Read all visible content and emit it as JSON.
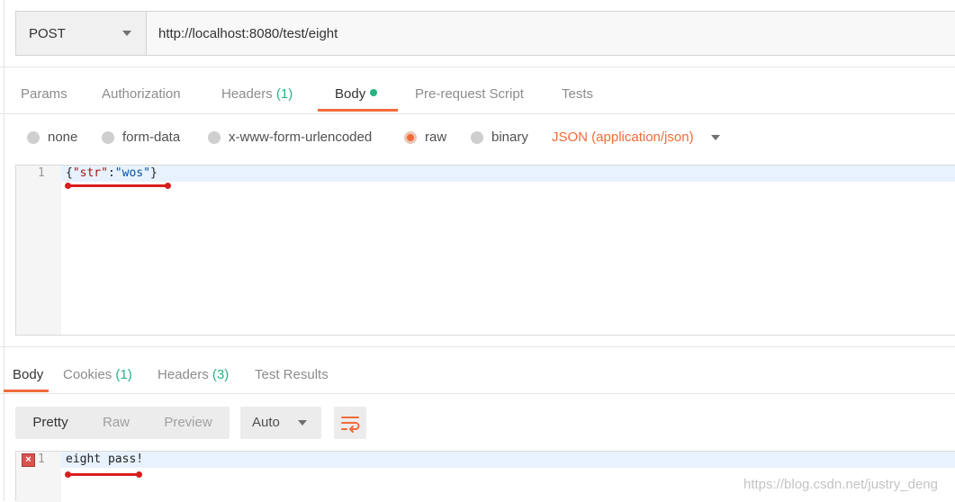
{
  "request": {
    "method": "POST",
    "url": "http://localhost:8080/test/eight"
  },
  "request_tabs": {
    "params": "Params",
    "authorization": "Authorization",
    "headers": "Headers",
    "headers_count": "(1)",
    "body": "Body",
    "prerequest": "Pre-request Script",
    "tests": "Tests"
  },
  "body_modes": {
    "none": "none",
    "form_data": "form-data",
    "urlencoded": "x-www-form-urlencoded",
    "raw": "raw",
    "binary": "binary",
    "selected": "raw",
    "content_type": "JSON (application/json)"
  },
  "request_editor": {
    "line_number": "1",
    "brace_open": "{",
    "key": "\"str\"",
    "colon": ":",
    "value": "\"wos\"",
    "brace_close": "}"
  },
  "response_tabs": {
    "body": "Body",
    "cookies": "Cookies",
    "cookies_count": "(1)",
    "headers": "Headers",
    "headers_count": "(3)",
    "test_results": "Test Results"
  },
  "response_toolbar": {
    "pretty": "Pretty",
    "raw": "Raw",
    "preview": "Preview",
    "format": "Auto"
  },
  "response_editor": {
    "error_icon": "×",
    "line_number": "1",
    "text": "eight pass!"
  },
  "watermark": "https://blog.csdn.net/justry_deng",
  "colors": {
    "accent": "#f26b3a",
    "count": "#26b47f",
    "annotation": "#d91e1e"
  }
}
